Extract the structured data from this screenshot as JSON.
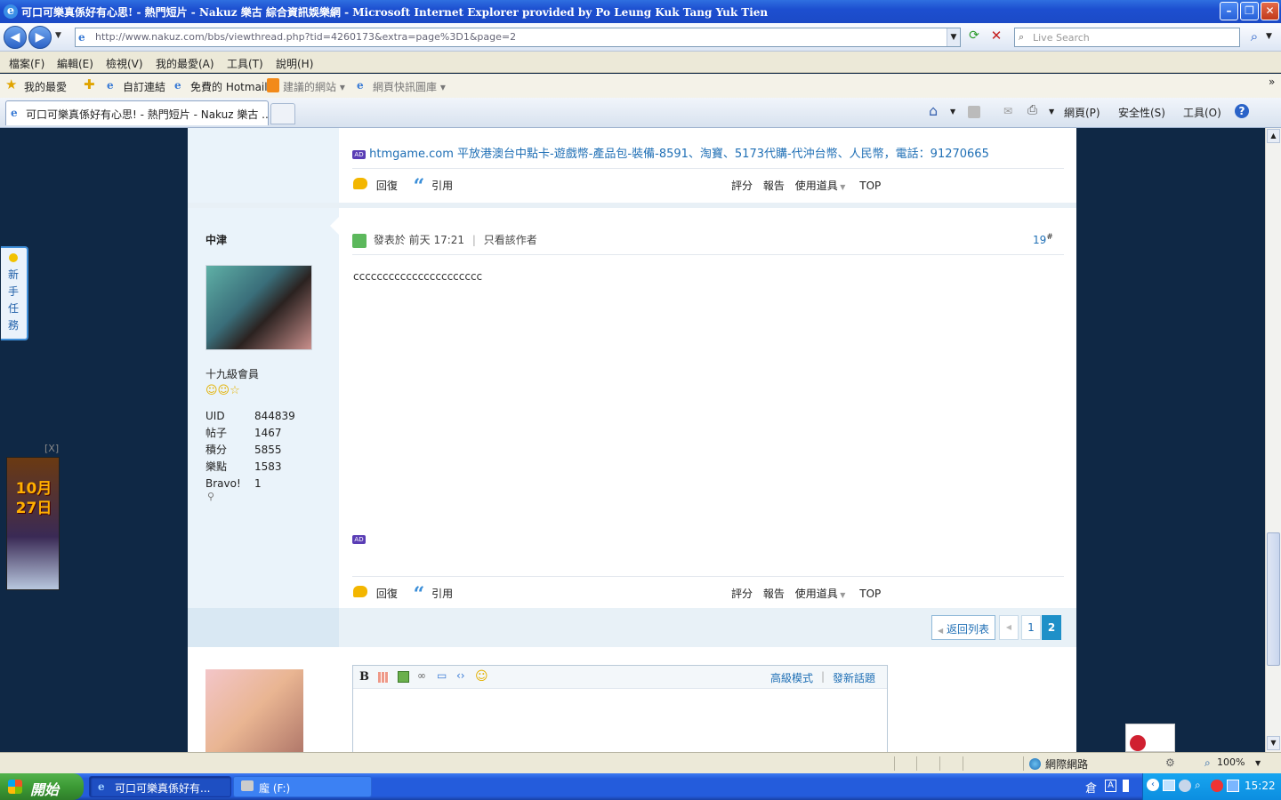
{
  "window": {
    "title": "可口可樂真係好有心思! - 熱門短片 - Nakuz 樂古 綜合資訊娛樂網 - Microsoft Internet Explorer provided by Po Leung Kuk Tang Yuk Tien"
  },
  "address_bar": {
    "url": "http://www.nakuz.com/bbs/viewthread.php?tid=4260173&extra=page%3D1&page=2",
    "search_placeholder": "Live Search"
  },
  "menu": [
    "檔案(F)",
    "編輯(E)",
    "檢視(V)",
    "我的最愛(A)",
    "工具(T)",
    "說明(H)"
  ],
  "favorites_bar": {
    "favorites": "我的最愛",
    "items": [
      "自訂連結",
      "免費的 Hotmail",
      "建議的網站 ▾",
      "網頁快訊圖庫 ▾"
    ]
  },
  "tabs": {
    "active": "可口可樂真係好有心思! - 熱門短片 - Nakuz 樂古 ...",
    "page_menu": "網頁(P)",
    "safety_menu": "安全性(S)",
    "tools_menu": "工具(O)"
  },
  "side_widget": {
    "text": "新手任務",
    "close_text": "[X]",
    "ad_date": "10月27日"
  },
  "top_post": {
    "ad_link": "htmgame.com 平放港澳台中點卡-遊戲幣-產品包-裝備-8591、淘寶、5173代購-代沖台幣、人民幣，電話：91270665",
    "actions": {
      "reply": "回復",
      "quote": "引用",
      "rate": "評分",
      "report": "報告",
      "use_tool": "使用道具",
      "top": "TOP"
    }
  },
  "post": {
    "author": "中津",
    "rank": "十九級會員",
    "stats": [
      {
        "label": "UID",
        "value": "844839"
      },
      {
        "label": "帖子",
        "value": "1467"
      },
      {
        "label": "積分",
        "value": "5855"
      },
      {
        "label": "樂點",
        "value": "1583"
      },
      {
        "label": "Bravo!",
        "value": "1"
      }
    ],
    "posted_prefix": "發表於",
    "posted_time": "前天 17:21",
    "only_author": "只看該作者",
    "floor": "19",
    "floor_suffix": "#",
    "message": "cccccccccccccccccccccc",
    "actions": {
      "reply": "回復",
      "quote": "引用",
      "rate": "評分",
      "report": "報告",
      "use_tool": "使用道具",
      "top": "TOP"
    }
  },
  "pagination": {
    "back_to_list": "返回列表",
    "pages": [
      "1",
      "2"
    ],
    "current": "2"
  },
  "reply_box": {
    "advanced_mode": "高級模式",
    "new_topic": "發新話題"
  },
  "status_bar": {
    "zone": "網際網路",
    "zoom": "100%"
  },
  "taskbar": {
    "start": "開始",
    "tasks": [
      "可口可樂真係好有...",
      "龐 (F:)"
    ],
    "clock": "15:22",
    "ime": "倉"
  },
  "colors": {
    "page_bg": "#0f2845",
    "link": "#1f6fb5",
    "current_page": "#1e90c8"
  }
}
